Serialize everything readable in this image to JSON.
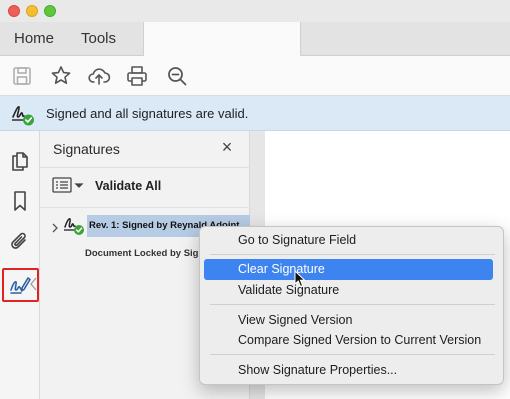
{
  "tabs": {
    "home": "Home",
    "tools": "Tools"
  },
  "toolbar": {
    "icons": [
      "save-icon",
      "bookmark-star-icon",
      "upload-cloud-icon",
      "print-icon",
      "zoom-search-icon"
    ]
  },
  "signature_bar": {
    "message": "Signed and all signatures are valid.",
    "icon": "signature-valid-icon"
  },
  "left_rail": {
    "icons": [
      "pages-icon",
      "bookmark-icon",
      "attachment-icon",
      "signature-pen-icon"
    ],
    "active_icon": "signature-pen-icon",
    "highlight_color": "#e02424"
  },
  "signatures_panel": {
    "title": "Signatures",
    "close_label": "×",
    "validate_all_label": "Validate All",
    "tree": {
      "revision_label": "Rev. 1: Signed by Reynald Adoint",
      "sub_label": "Document Locked by Signature"
    }
  },
  "context_menu": {
    "items": [
      {
        "label": "Go to Signature Field",
        "highlighted": false
      },
      {
        "label": "Clear Signature",
        "highlighted": true
      },
      {
        "label": "Validate Signature",
        "highlighted": false
      },
      {
        "label": "View Signed Version",
        "highlighted": false
      },
      {
        "label": "Compare Signed Version to Current Version",
        "highlighted": false
      },
      {
        "label": "Show Signature Properties...",
        "highlighted": false
      }
    ],
    "highlight_color": "#3d84f0"
  }
}
